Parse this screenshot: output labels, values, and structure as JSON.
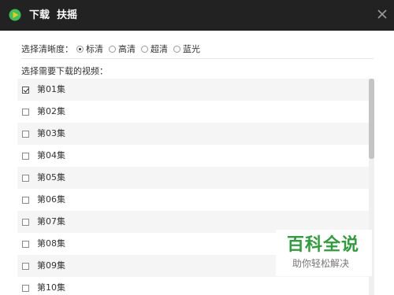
{
  "window": {
    "title_prefix": "下载",
    "title_name": "扶摇"
  },
  "quality": {
    "label": "选择清晰度：",
    "options": [
      {
        "label": "标清",
        "selected": true
      },
      {
        "label": "高清",
        "selected": false
      },
      {
        "label": "超清",
        "selected": false
      },
      {
        "label": "蓝光",
        "selected": false
      }
    ]
  },
  "episodes": {
    "label": "选择需要下载的视频：",
    "items": [
      {
        "label": "第01集",
        "checked": true
      },
      {
        "label": "第02集",
        "checked": false
      },
      {
        "label": "第03集",
        "checked": false
      },
      {
        "label": "第04集",
        "checked": false
      },
      {
        "label": "第05集",
        "checked": false
      },
      {
        "label": "第06集",
        "checked": false
      },
      {
        "label": "第07集",
        "checked": false
      },
      {
        "label": "第08集",
        "checked": false
      },
      {
        "label": "第09集",
        "checked": false
      },
      {
        "label": "第10集",
        "checked": false
      }
    ]
  },
  "watermark": {
    "brand": "百科全说",
    "slogan": "助你轻松解决"
  },
  "colors": {
    "titlebar": "#222222",
    "brand_green": "#2e9e3a",
    "logo_green": "#3dbf5a",
    "logo_yellow": "#f5c518"
  }
}
